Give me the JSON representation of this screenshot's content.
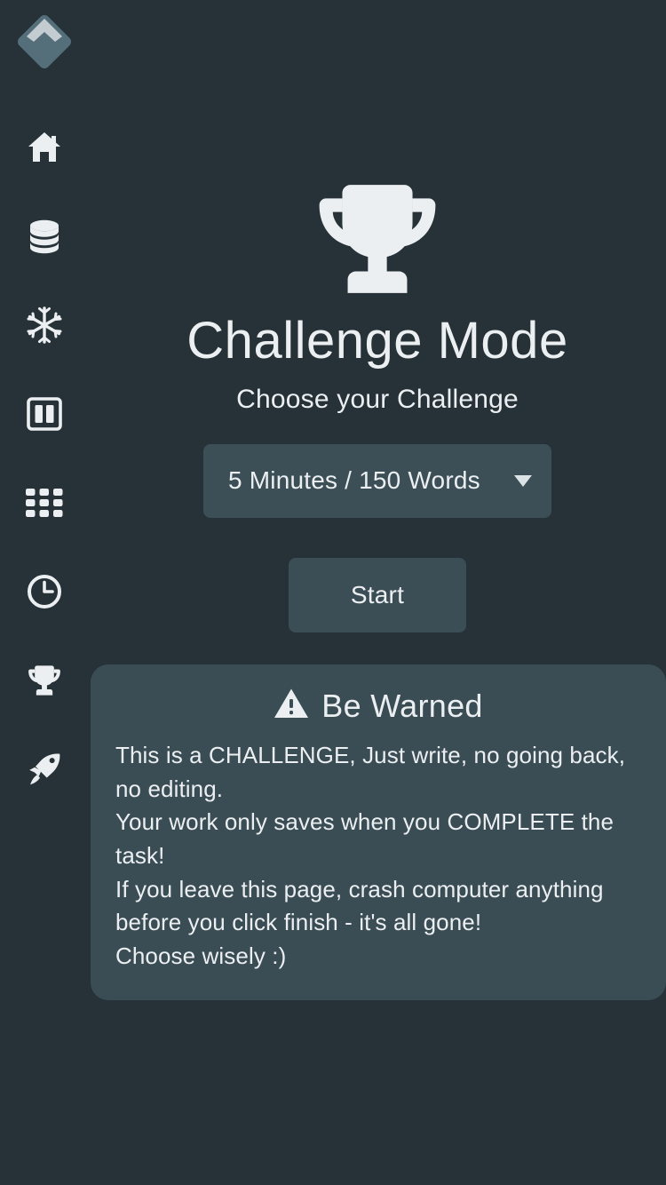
{
  "app": {
    "logo_name": "app-logo",
    "background_color": "#263238",
    "panel_color": "#3a4c54",
    "accent_color": "#546e7a",
    "text_color": "#eceff1"
  },
  "sidebar": {
    "items": [
      {
        "icon": "home-icon",
        "name": "sidebar-item-home"
      },
      {
        "icon": "database-icon",
        "name": "sidebar-item-database"
      },
      {
        "icon": "snowflake-icon",
        "name": "sidebar-item-snowflake"
      },
      {
        "icon": "columns-icon",
        "name": "sidebar-item-columns"
      },
      {
        "icon": "grid-icon",
        "name": "sidebar-item-grid"
      },
      {
        "icon": "clock-icon",
        "name": "sidebar-item-clock"
      },
      {
        "icon": "trophy-icon",
        "name": "sidebar-item-trophy"
      },
      {
        "icon": "rocket-icon",
        "name": "sidebar-item-rocket"
      }
    ]
  },
  "main": {
    "hero_icon": "trophy-icon",
    "title": "Challenge Mode",
    "subtitle": "Choose your Challenge",
    "challenge_select": {
      "value": "5 Minutes / 150 Words",
      "caret_icon": "chevron-down-icon"
    },
    "start_label": "Start"
  },
  "warning": {
    "icon": "warning-triangle-icon",
    "title": "Be Warned",
    "lines": [
      "This is a CHALLENGE, Just write, no going back, no editing.",
      "Your work only saves when you COMPLETE the task!",
      "If you leave this page, crash computer anything before you click finish - it's all gone!",
      "Choose wisely :)"
    ]
  }
}
